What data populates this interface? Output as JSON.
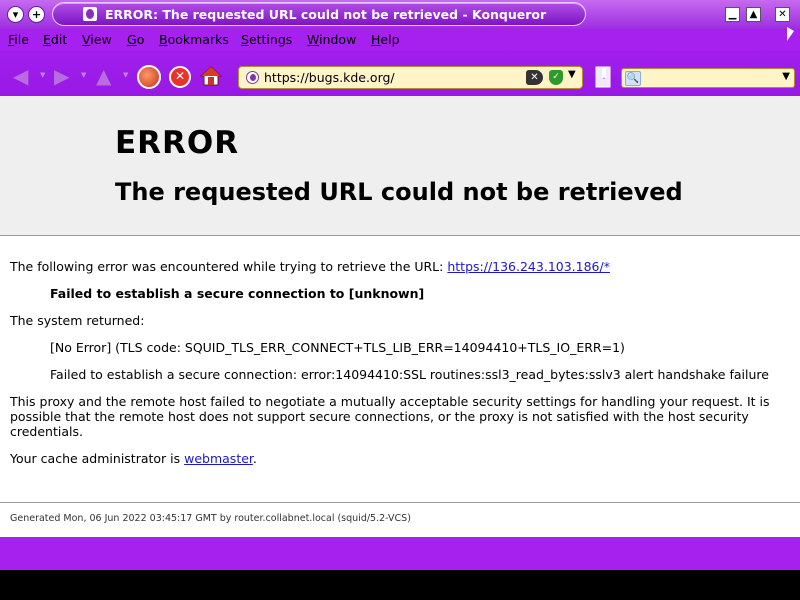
{
  "window": {
    "title": "ERROR: The requested URL could not be retrieved - Konqueror",
    "left_buttons": [
      "▾",
      "+"
    ],
    "controls": [
      "▁",
      "▲",
      "✕"
    ]
  },
  "menu": {
    "items": [
      "File",
      "Edit",
      "View",
      "Go",
      "Bookmarks",
      "Settings",
      "Window",
      "Help"
    ]
  },
  "toolbar": {
    "url": "https://bugs.kde.org/",
    "search_value": ""
  },
  "page": {
    "h1": "ERROR",
    "h2": "The requested URL could not be retrieved",
    "intro": "The following error was encountered while trying to retrieve the URL: ",
    "intro_link": "https://136.243.103.186/*",
    "failed": "Failed to establish a secure connection to [unknown]",
    "system_returned": "The system returned:",
    "tls_code": "[No Error] (TLS code: SQUID_TLS_ERR_CONNECT+TLS_LIB_ERR=14094410+TLS_IO_ERR=1)",
    "ssl_error": "Failed to establish a secure connection: error:14094410:SSL routines:ssl3_read_bytes:sslv3 alert handshake failure",
    "explain_1": "This proxy and the remote host failed to negotiate a mutually acceptable security settings for handling your request. It is",
    "explain_2": "possible that the remote host does not support secure connections, or the proxy is not satisfied with the host security",
    "explain_3": "credentials.",
    "admin_prefix": "Your cache administrator is ",
    "admin_link": "webmaster",
    "admin_suffix": ".",
    "footer": "Generated Mon, 06 Jun 2022 03:45:17 GMT by router.collabnet.local (squid/5.2-VCS)"
  },
  "colors": {
    "chrome_purple": "#a621ee",
    "url_bg": "#fff3c8",
    "link": "#1a1ac8"
  }
}
